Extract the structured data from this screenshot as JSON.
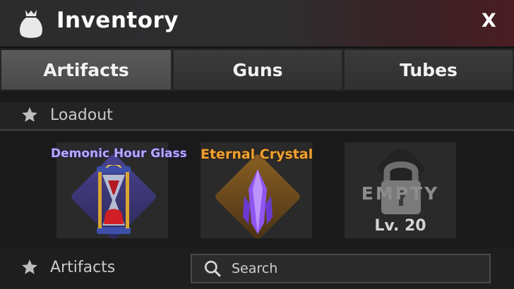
{
  "header": {
    "title": "Inventory",
    "close_label": "X",
    "bag_icon": "bag-icon"
  },
  "tabs": [
    {
      "label": "Artifacts",
      "active": true
    },
    {
      "label": "Guns",
      "active": false
    },
    {
      "label": "Tubes",
      "active": false
    }
  ],
  "loadout": {
    "title": "Loadout",
    "slots": [
      {
        "name": "Demonic Hour Glass",
        "name_color": "#b7a8ff",
        "icon": "hourglass-icon"
      },
      {
        "name": "Eternal Crystal",
        "name_color": "#f0a030",
        "icon": "crystal-icon"
      },
      {
        "status": "EMPTY",
        "level": "Lv. 20",
        "icon": "lock-icon"
      }
    ]
  },
  "artifacts": {
    "title": "Artifacts"
  },
  "search": {
    "placeholder": "Search"
  }
}
